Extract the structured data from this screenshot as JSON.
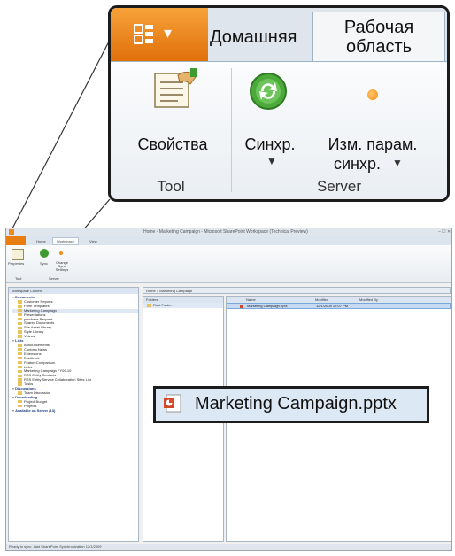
{
  "zoom_ribbon": {
    "tabs": {
      "home": "Домашняя",
      "workspace_line1": "Рабочая",
      "workspace_line2": "область"
    },
    "buttons": {
      "properties": "Свойства",
      "sync": "Синхр.",
      "sync_settings_line1": "Изм. парам.",
      "sync_settings_line2": "синхр."
    },
    "groups": {
      "tool": "Tool",
      "server": "Server"
    }
  },
  "window": {
    "title": "Home - Marketing Campaign - Microsoft SharePoint Workspace (Technical Preview)",
    "tabs": [
      "File",
      "Home",
      "Workspace",
      "View"
    ],
    "ribbon": {
      "properties": "Properties",
      "sync": "Sync",
      "change_sync": "Change Sync Settings",
      "group_tool": "Tool",
      "group_server": "Server"
    },
    "left_pane": {
      "header": "Workspace Content",
      "items": [
        {
          "text": "Documents",
          "bold": true
        },
        {
          "text": "Customer Reports"
        },
        {
          "text": "Form Templates"
        },
        {
          "text": "Marketing Campaign"
        },
        {
          "text": "Presentations"
        },
        {
          "text": "purchase Request"
        },
        {
          "text": "Shared Documents"
        },
        {
          "text": "Site Asset Library"
        },
        {
          "text": "Style Library"
        },
        {
          "text": "Videos"
        },
        {
          "text": "Lists",
          "bold": true
        },
        {
          "text": "Announcements"
        },
        {
          "text": "Contoso News"
        },
        {
          "text": "Extensions"
        },
        {
          "text": "Feedback"
        },
        {
          "text": "FeatureComparison"
        },
        {
          "text": "Links"
        },
        {
          "text": "Marketing Campaign FY09-10"
        },
        {
          "text": "RSS Entity Contacts"
        },
        {
          "text": "RSS Entity Service Collaboration Sites List"
        },
        {
          "text": "Tasks"
        },
        {
          "text": "Discussions",
          "bold": true
        },
        {
          "text": "Team Discussion"
        },
        {
          "text": "Downloading",
          "bold": true
        },
        {
          "text": "Project Budget"
        },
        {
          "text": "Projects"
        },
        {
          "text": "Available on Server (13)",
          "bold": true
        }
      ]
    },
    "breadcrumb": "Home > Marketing Campaign",
    "folders": {
      "header": "Folders",
      "root": "Root Folder"
    },
    "columns": [
      "Name",
      "Modified",
      "Modified By"
    ],
    "row": {
      "name": "Marketing Campaign.pptx",
      "modified": "12/1/2009 12:07 PM",
      "modified_by": ""
    },
    "status": "Ready to sync. Last SharePoint Synchronization 12/1/2009"
  },
  "file_callout": {
    "name": "Marketing Campaign.pptx"
  },
  "colors": {
    "app_button": "#e87d14",
    "sync_green": "#3e9b2f",
    "dot_orange": "#f28c1a",
    "selection": "#c6daf2"
  }
}
